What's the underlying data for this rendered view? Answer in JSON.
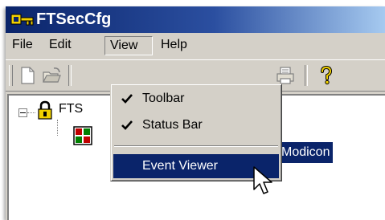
{
  "window": {
    "title": "FTSecCfg"
  },
  "menubar": {
    "items": [
      {
        "label": "File"
      },
      {
        "label": "Edit"
      },
      {
        "label": "View"
      },
      {
        "label": "Help"
      }
    ]
  },
  "view_menu": {
    "items": [
      {
        "label": "Toolbar",
        "checked": true
      },
      {
        "label": "Status Bar",
        "checked": true
      },
      {
        "label": "Event Viewer",
        "checked": false
      }
    ]
  },
  "tree": {
    "root_label": "FTS",
    "child_label": "Modicon"
  },
  "icons": {
    "title": "key-icon",
    "new": "new-document-icon",
    "open": "open-folder-icon",
    "print": "printer-icon",
    "help": "help-question-icon",
    "root": "lock-icon",
    "child": "device-icon",
    "check": "checkmark-icon",
    "cursor": "mouse-pointer-icon"
  },
  "colors": {
    "selection": "#0a246a",
    "titlebar": "#0a246a",
    "face": "#d4d0c8"
  }
}
